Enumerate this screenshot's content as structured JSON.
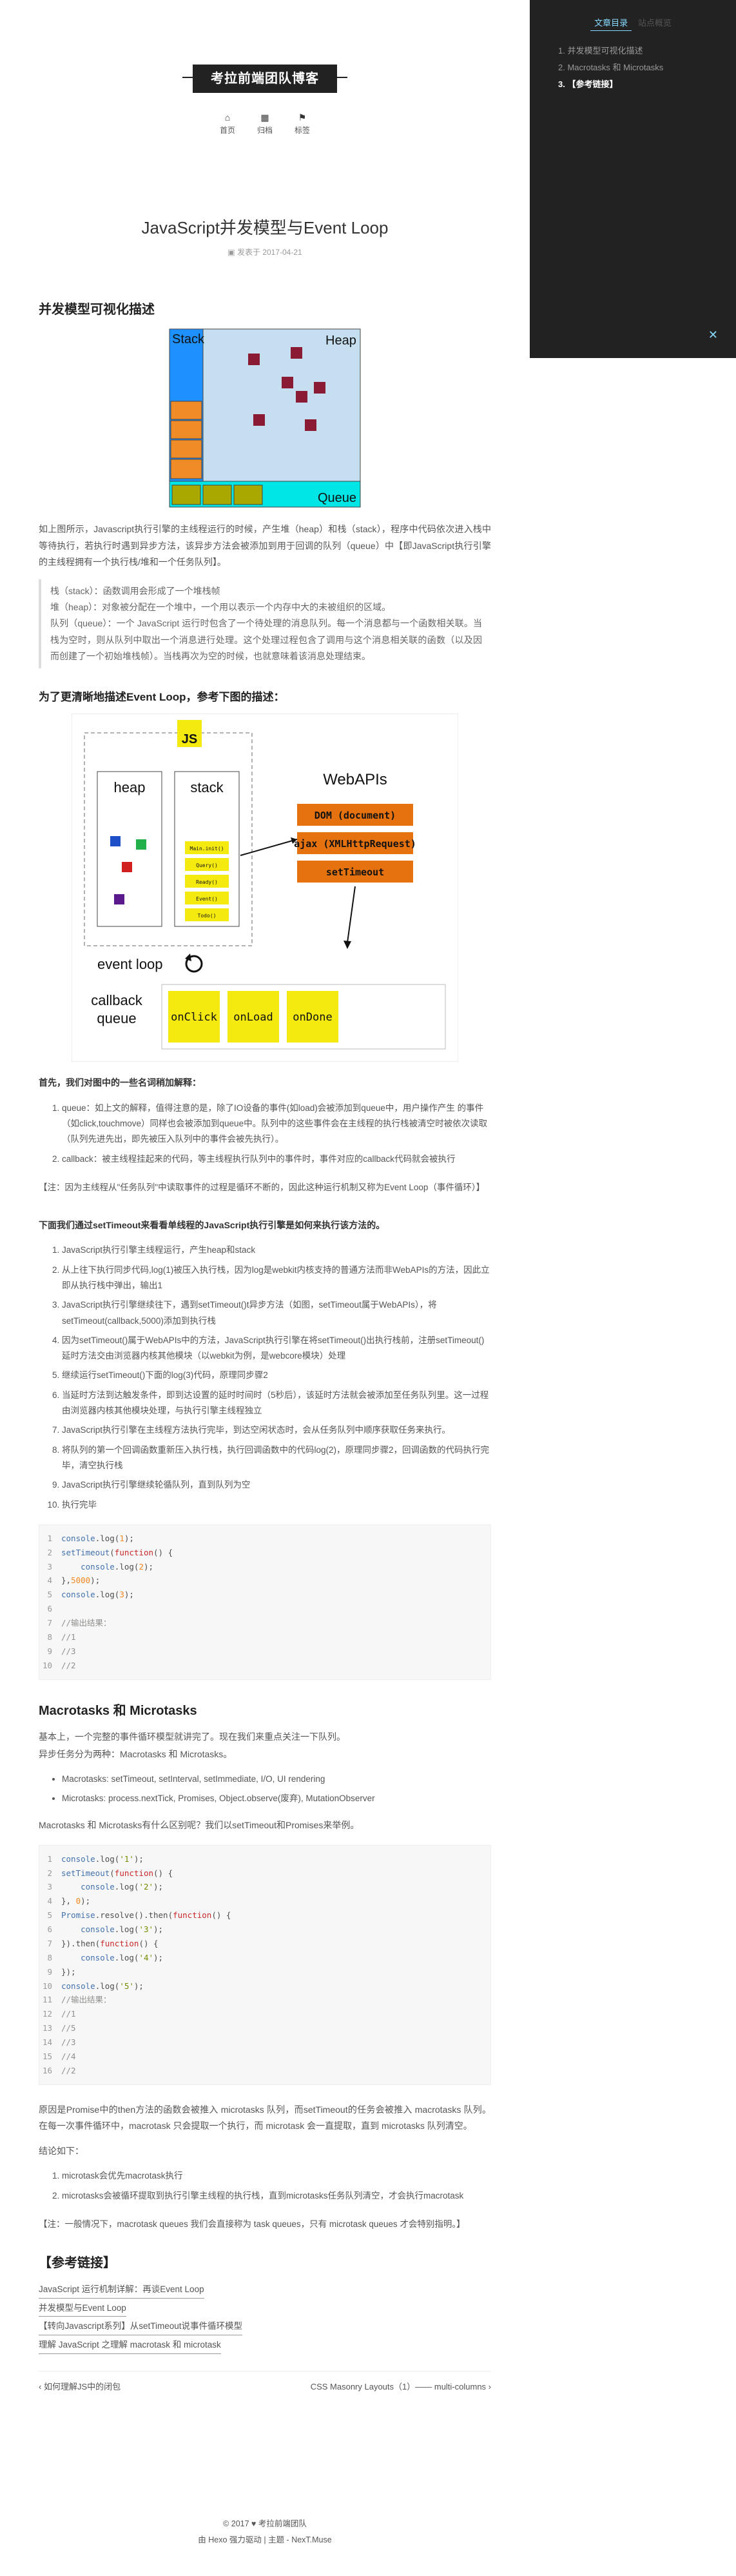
{
  "sidebar": {
    "tab_toc": "文章目录",
    "tab_overview": "站点概览",
    "toc": [
      "1. 并发模型可视化描述",
      "2. Macrotasks 和 Microtasks",
      "3. 【参考链接】"
    ]
  },
  "header": {
    "brand": "考拉前端团队博客",
    "menu": [
      {
        "icon": "home-icon",
        "glyph": "⌂",
        "label": "首页"
      },
      {
        "icon": "archive-icon",
        "glyph": "▦",
        "label": "归档"
      },
      {
        "icon": "tags-icon",
        "glyph": "⚑",
        "label": "标签"
      }
    ]
  },
  "post": {
    "title": "JavaScript并发模型与Event Loop",
    "meta": "发表于 2017-04-21",
    "sec1": "并发模型可视化描述",
    "fig1": {
      "stack": "Stack",
      "heap": "Heap",
      "queue": "Queue"
    },
    "p1": "如上图所示，Javascript执行引擎的主线程运行的时候，产生堆（heap）和栈（stack），程序中代码依次进入栈中等待执行，若执行时遇到异步方法，该异步方法会被添加到用于回调的队列（queue）中【即JavaScript执行引擎的主线程拥有一个执行栈/堆和一个任务队列】。",
    "quote": [
      "栈（stack）：函数调用会形成了一个堆栈帧",
      "堆（heap）：对象被分配在一个堆中，一个用以表示一个内存中大的未被组织的区域。",
      "队列（queue）：一个 JavaScript 运行时包含了一个待处理的消息队列。每一个消息都与一个函数相关联。当栈为空时，则从队列中取出一个消息进行处理。这个处理过程包含了调用与这个消息相关联的函数（以及因而创建了一个初始堆栈帧）。当栈再次为空的时候，也就意味着该消息处理结束。"
    ],
    "h3a": "为了更清晰地描述Event Loop，参考下图的描述：",
    "fig2": {
      "js": "JS",
      "heap": "heap",
      "stack": "stack",
      "stack_items": [
        "Main.init()",
        "Query()",
        "Ready()",
        "Event()",
        "Todo()"
      ],
      "webapis": "WebAPIs",
      "apis": [
        "DOM (document)",
        "ajax (XMLHttpRequest)",
        "setTimeout"
      ],
      "loop": "event loop",
      "cbq1": "callback",
      "cbq2": "queue",
      "cbs": [
        "onClick",
        "onLoad",
        "onDone"
      ]
    },
    "intro_b": "首先，我们对图中的一些名词稍加解释：",
    "terms": [
      "queue：如上文的解释，值得注意的是，除了IO设备的事件(如load)会被添加到queue中，用户操作产生 的事件（如click,touchmove）同样也会被添加到queue中。队列中的这些事件会在主线程的执行栈被清空时被依次读取（队列先进先出，即先被压入队列中的事件会被先执行）。",
      "callback：被主线程挂起来的代码，等主线程执行队列中的事件时，事件对应的callback代码就会被执行"
    ],
    "note1": "【注：因为主线程从\"任务队列\"中读取事件的过程是循环不断的，因此这种运行机制又称为Event Loop（事件循环）】",
    "h_steps": "下面我们通过setTimeout来看看单线程的JavaScript执行引擎是如何来执行该方法的。",
    "steps": [
      "JavaScript执行引擎主线程运行，产生heap和stack",
      "从上往下执行同步代码,log(1)被压入执行栈，因为log是webkit内核支持的普通方法而非WebAPIs的方法，因此立即从执行栈中弹出，输出1",
      "JavaScript执行引擎继续往下，遇到setTimeout()t异步方法（如图，setTimeout属于WebAPIs），将setTimeout(callback,5000)添加到执行栈",
      "因为setTimeout()属于WebAPIs中的方法，JavaScript执行引擎在将setTimeout()出执行栈前，注册setTimeout()延时方法交由浏览器内核其他模块（以webkit为例，是webcore模块）处理",
      "继续运行setTimeout()下面的log(3)代码，原理同步骤2",
      "当延时方法到达触发条件，即到达设置的延时时间时（5秒后），该延时方法就会被添加至任务队列里。这一过程由浏览器内核其他模块处理，与执行引擎主线程独立",
      "JavaScript执行引擎在主线程方法执行完毕，到达空闲状态时，会从任务队列中顺序获取任务来执行。",
      "将队列的第一个回调函数重新压入执行栈，执行回调函数中的代码log(2)，原理同步骤2，回调函数的代码执行完毕，清空执行栈",
      "JavaScript执行引擎继续轮循队列，直到队列为空",
      "执行完毕"
    ],
    "code1": [
      [
        {
          "c": "fn",
          "t": "console"
        },
        {
          "c": "",
          "t": ".log("
        },
        {
          "c": "num",
          "t": "1"
        },
        {
          "c": "",
          "t": ");"
        }
      ],
      [
        {
          "c": "fn",
          "t": "setTimeout"
        },
        {
          "c": "",
          "t": "("
        },
        {
          "c": "kw",
          "t": "function"
        },
        {
          "c": "",
          "t": "() {"
        }
      ],
      [
        {
          "c": "",
          "t": "    "
        },
        {
          "c": "fn",
          "t": "console"
        },
        {
          "c": "",
          "t": ".log("
        },
        {
          "c": "num",
          "t": "2"
        },
        {
          "c": "",
          "t": ");"
        }
      ],
      [
        {
          "c": "",
          "t": "},"
        },
        {
          "c": "num",
          "t": "5000"
        },
        {
          "c": "",
          "t": ");"
        }
      ],
      [
        {
          "c": "fn",
          "t": "console"
        },
        {
          "c": "",
          "t": ".log("
        },
        {
          "c": "num",
          "t": "3"
        },
        {
          "c": "",
          "t": ");"
        }
      ],
      [
        {
          "c": "",
          "t": ""
        }
      ],
      [
        {
          "c": "cm",
          "t": "//输出结果："
        }
      ],
      [
        {
          "c": "cm",
          "t": "//1"
        }
      ],
      [
        {
          "c": "cm",
          "t": "//3"
        }
      ],
      [
        {
          "c": "cm",
          "t": "//2"
        }
      ]
    ],
    "sec2": "Macrotasks 和 Microtasks",
    "p2": "基本上，一个完整的事件循环模型就讲完了。现在我们来重点关注一下队列。",
    "p3": "异步任务分为两种：Macrotasks 和 Microtasks。",
    "bullets": [
      "Macrotasks: setTimeout, setInterval, setImmediate, I/O, UI rendering",
      "Microtasks: process.nextTick, Promises, Object.observe(废弃), MutationObserver"
    ],
    "p4": "Macrotasks 和 Microtasks有什么区别呢？我们以setTimeout和Promises来举例。",
    "code2": [
      [
        {
          "c": "fn",
          "t": "console"
        },
        {
          "c": "",
          "t": ".log("
        },
        {
          "c": "str",
          "t": "'1'"
        },
        {
          "c": "",
          "t": ");"
        }
      ],
      [
        {
          "c": "fn",
          "t": "setTimeout"
        },
        {
          "c": "",
          "t": "("
        },
        {
          "c": "kw",
          "t": "function"
        },
        {
          "c": "",
          "t": "() {"
        }
      ],
      [
        {
          "c": "",
          "t": "    "
        },
        {
          "c": "fn",
          "t": "console"
        },
        {
          "c": "",
          "t": ".log("
        },
        {
          "c": "str",
          "t": "'2'"
        },
        {
          "c": "",
          "t": ");"
        }
      ],
      [
        {
          "c": "",
          "t": "}, "
        },
        {
          "c": "num",
          "t": "0"
        },
        {
          "c": "",
          "t": ");"
        }
      ],
      [
        {
          "c": "fn",
          "t": "Promise"
        },
        {
          "c": "",
          "t": ".resolve().then("
        },
        {
          "c": "kw",
          "t": "function"
        },
        {
          "c": "",
          "t": "() {"
        }
      ],
      [
        {
          "c": "",
          "t": "    "
        },
        {
          "c": "fn",
          "t": "console"
        },
        {
          "c": "",
          "t": ".log("
        },
        {
          "c": "str",
          "t": "'3'"
        },
        {
          "c": "",
          "t": ");"
        }
      ],
      [
        {
          "c": "",
          "t": "}).then("
        },
        {
          "c": "kw",
          "t": "function"
        },
        {
          "c": "",
          "t": "() {"
        }
      ],
      [
        {
          "c": "",
          "t": "    "
        },
        {
          "c": "fn",
          "t": "console"
        },
        {
          "c": "",
          "t": ".log("
        },
        {
          "c": "str",
          "t": "'4'"
        },
        {
          "c": "",
          "t": ");"
        }
      ],
      [
        {
          "c": "",
          "t": "});"
        }
      ],
      [
        {
          "c": "fn",
          "t": "console"
        },
        {
          "c": "",
          "t": ".log("
        },
        {
          "c": "str",
          "t": "'5'"
        },
        {
          "c": "",
          "t": ");"
        }
      ],
      [
        {
          "c": "cm",
          "t": "//输出结果："
        }
      ],
      [
        {
          "c": "cm",
          "t": "//1"
        }
      ],
      [
        {
          "c": "cm",
          "t": "//5"
        }
      ],
      [
        {
          "c": "cm",
          "t": "//3"
        }
      ],
      [
        {
          "c": "cm",
          "t": "//4"
        }
      ],
      [
        {
          "c": "cm",
          "t": "//2"
        }
      ]
    ],
    "p5": "原因是Promise中的then方法的函数会被推入 microtasks 队列，而setTimeout的任务会被推入 macrotasks 队列。在每一次事件循环中，macrotask 只会提取一个执行，而 microtask 会一直提取，直到 microtasks 队列清空。",
    "p6": "结论如下：",
    "concl": [
      "microtask会优先macrotask执行",
      "microtasks会被循环提取到执行引擎主线程的执行栈，直到microtasks任务队列清空，才会执行macrotask"
    ],
    "note2": "【注：一般情况下，macrotask queues 我们会直接称为 task queues，只有 microtask queues 才会特别指明。】",
    "sec3": "【参考链接】",
    "refs": [
      "JavaScript 运行机制详解：再谈Event Loop",
      "并发模型与Event Loop",
      "【转向Javascript系列】从setTimeout说事件循环模型",
      "理解 JavaScript 之理解 macrotask 和 microtask"
    ],
    "prev": "‹ 如何理解JS中的闭包",
    "next": "CSS Masonry Layouts（1）—— multi-columns ›"
  },
  "footer": {
    "copyright": "© 2017 ♥ 考拉前端团队",
    "powered": "由 Hexo 强力驱动  |  主题 - NexT.Muse"
  },
  "colors": {
    "fig1_stack": "#1e90ff",
    "fig1_heap": "#c5dff0",
    "fig1_queue": "#00e5e5",
    "fig1_slot": "#f08c28",
    "fig1_item": "#a8a800",
    "fig1_dot": "#8b1a35",
    "fig2_api": "#e5720f",
    "fig2_cb": "#f5ea10"
  }
}
